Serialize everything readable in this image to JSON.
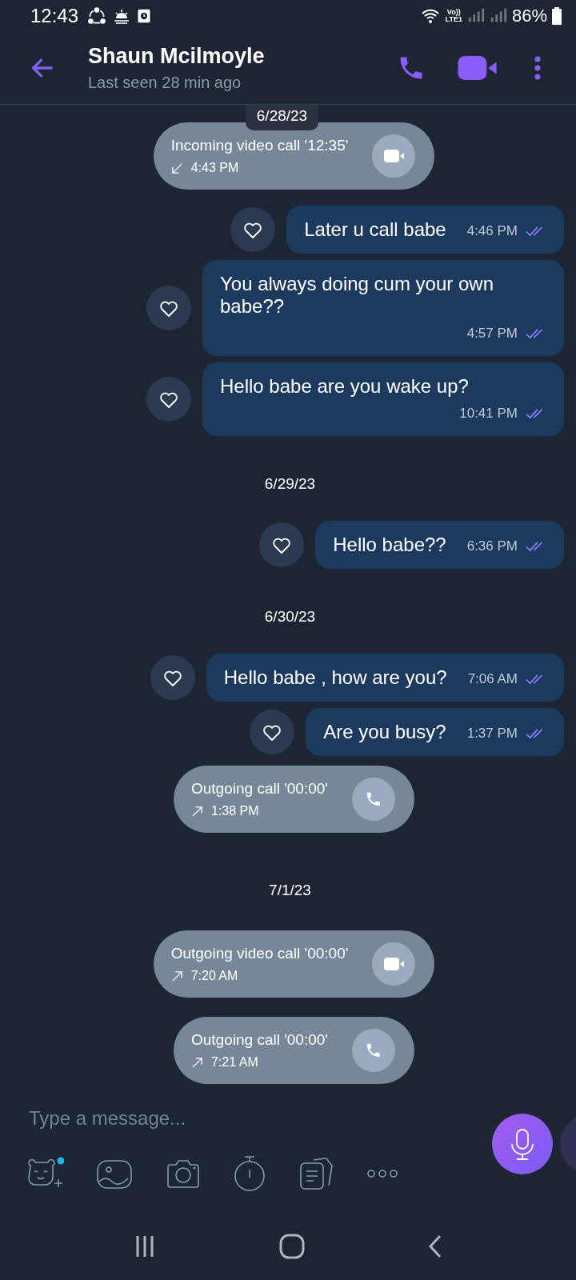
{
  "status_bar": {
    "time": "12:43",
    "network": "Vo))\nLTE1",
    "battery": "86%"
  },
  "header": {
    "name": "Shaun Mcilmoyle",
    "last_seen": "Last seen 28 min ago"
  },
  "items": [
    {
      "kind": "date",
      "text": "6/28/23",
      "floating": true
    },
    {
      "kind": "call",
      "video": true,
      "incoming": true,
      "text": "Incoming video call '12:35'",
      "time": "4:43 PM"
    },
    {
      "kind": "message",
      "text": "Later u call babe",
      "time": "4:46 PM",
      "liked": false
    },
    {
      "kind": "message",
      "text": "You always doing cum your own babe??",
      "time": "4:57 PM",
      "liked": false
    },
    {
      "kind": "message",
      "text": "Hello babe are you wake up?",
      "time": "10:41 PM",
      "liked": false
    },
    {
      "kind": "date",
      "text": "6/29/23",
      "floating": false
    },
    {
      "kind": "message",
      "text": "Hello babe??",
      "time": "6:36 PM",
      "liked": false
    },
    {
      "kind": "date",
      "text": "6/30/23",
      "floating": false
    },
    {
      "kind": "message",
      "text": "Hello babe  , how are you?",
      "time": "7:06 AM",
      "liked": false
    },
    {
      "kind": "message",
      "text": "Are you busy?",
      "time": "1:37 PM",
      "liked": false
    },
    {
      "kind": "call",
      "video": false,
      "incoming": false,
      "text": "Outgoing call '00:00'",
      "time": "1:38 PM"
    },
    {
      "kind": "date",
      "text": "7/1/23",
      "floating": false
    },
    {
      "kind": "call",
      "video": true,
      "incoming": false,
      "text": "Outgoing video call '00:00'",
      "time": "7:20 AM"
    },
    {
      "kind": "call",
      "video": false,
      "incoming": false,
      "text": "Outgoing call '00:00'",
      "time": "7:21 AM"
    }
  ],
  "composer": {
    "placeholder": "Type a message..."
  }
}
